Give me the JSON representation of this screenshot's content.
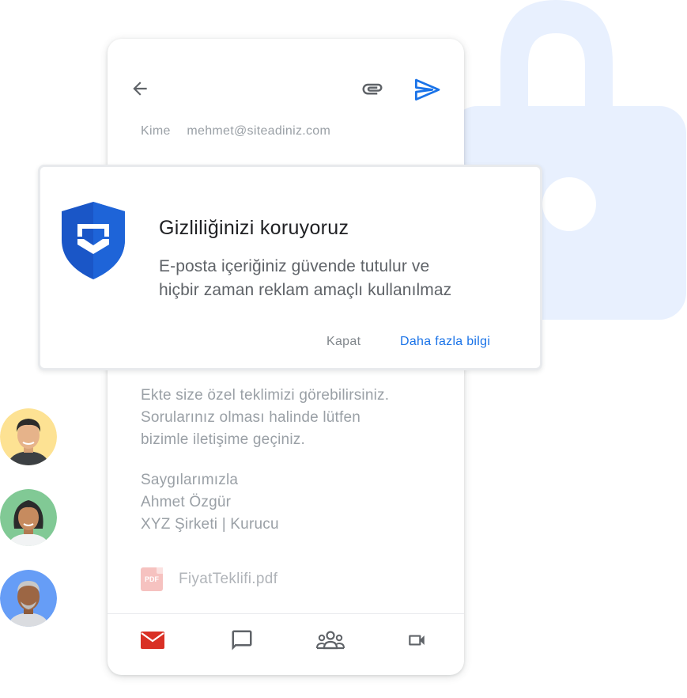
{
  "colors": {
    "accent": "#1a73e8",
    "shield": "#1a56c7",
    "lock_bg": "#e8f0fe",
    "mail_red": "#d93025",
    "avatar_yellow": "#fde293",
    "avatar_green": "#81c995",
    "avatar_blue": "#669df6"
  },
  "compose": {
    "to_label": "Kime",
    "to_value": "mehmet@siteadiniz.com",
    "body_lines": [
      "Ekte size özel teklimizi görebilirsiniz.",
      "Sorularınız olması halinde lütfen",
      "bizimle iletişime geçiniz."
    ],
    "signature_lines": [
      "Saygılarımızla",
      "Ahmet Özgür",
      "XYZ Şirketi | Kurucu"
    ],
    "attachment": {
      "icon_label": "PDF",
      "file_name": "FiyatTeklifi.pdf"
    }
  },
  "dialog": {
    "title": "Gizliliğinizi koruyoruz",
    "description_lines": [
      "E-posta içeriğiniz güvende tutulur ve",
      "hiçbir zaman reklam amaçlı kullanılmaz"
    ],
    "close_label": "Kapat",
    "more_label": "Daha fazla bilgi"
  },
  "icons": {
    "toolbar": [
      "arrow-back-icon",
      "attach-icon",
      "send-icon"
    ],
    "bottom_nav": [
      "mail-icon",
      "chat-icon",
      "people-icon",
      "video-icon"
    ]
  }
}
